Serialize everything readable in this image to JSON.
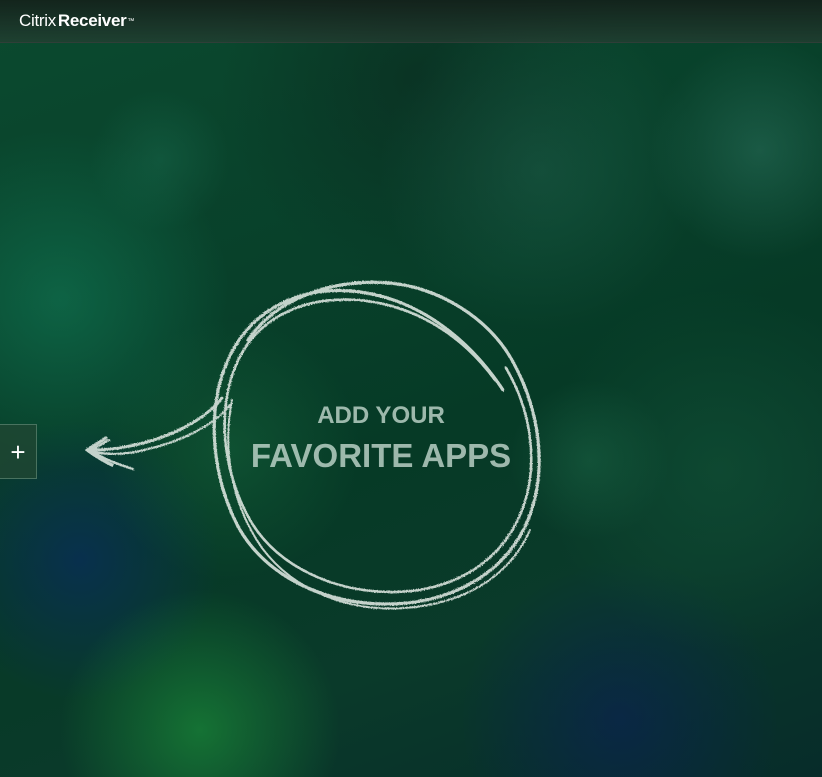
{
  "app": {
    "brand_light": "Citrix",
    "brand_bold": "Receiver",
    "trademark": "™"
  },
  "add_button": {
    "label": "+"
  },
  "empty_state": {
    "line1": "ADD YOUR",
    "line2": "FAVORITE APPS"
  },
  "colors": {
    "background_green": "#06331e",
    "chalk_white": "#dfe8e2",
    "text_muted": "#c8dcd2"
  }
}
